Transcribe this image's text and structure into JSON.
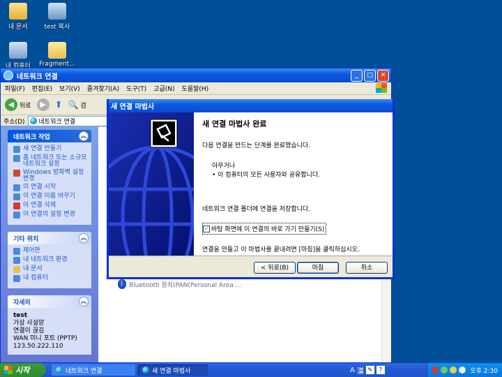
{
  "desktop": {
    "icons": [
      {
        "label": "내 문서",
        "icon": "my-documents-icon"
      },
      {
        "label": "test 복사",
        "icon": "test-copy-icon"
      },
      {
        "label": "내 컴퓨터",
        "icon": "my-computer-icon"
      },
      {
        "label": "Fragment...",
        "icon": "fragment-icon"
      }
    ]
  },
  "explorer": {
    "title": "네트워크 연결",
    "menu": [
      "파일(F)",
      "편집(E)",
      "보기(V)",
      "즐겨찾기(A)",
      "도구(T)",
      "고급(N)",
      "도움말(H)"
    ],
    "toolbar": {
      "back": "뒤로",
      "search": "검"
    },
    "address_label": "주소(D)",
    "address_value": "네트워크 연결",
    "panels": {
      "network_tasks": {
        "title": "네트워크 작업",
        "items": [
          "새 연결 만들기",
          "홈 네트워크 또는 소규모 네트워크 설정",
          "Windows 방화벽 설정 변경",
          "이 연결 시작",
          "이 연결 이름 바꾸기",
          "이 연결 삭제",
          "이 연결의 설정 변경"
        ]
      },
      "other_places": {
        "title": "기타 위치",
        "items": [
          "제어판",
          "내 네트워크 환경",
          "내 문서",
          "내 컴퓨터"
        ]
      },
      "details": {
        "title": "자세히",
        "name": "test",
        "lines": [
          "가상 사설망",
          "연결이 끊김",
          "WAN 미니 포트 (PPTP)",
          "123.50.222.110"
        ]
      }
    },
    "content_item": "Bluetooth 장치(PAN(Personal Area ..."
  },
  "wizard": {
    "title": "새 연결 마법사",
    "heading": "새 연결 마법사 완료",
    "intro": "다음 연결을 만드는 단계를 완료했습니다.",
    "conn_name": "아무거나",
    "conn_detail": "• 이 컴퓨터의 모든 사용자와 공유합니다.",
    "save_text": "네트워크 연결 폴더에 연결을 저장합니다.",
    "shortcut_label": "바탕 화면에 이 연결의 바로 가기 만들기(S)",
    "shortcut_checked": true,
    "finish_text": "연결을 만들고 이 마법사를 끝내려면 [마침]을 클릭하십시오.",
    "buttons": {
      "back": "< 뒤로(B)",
      "finish": "마침",
      "cancel": "취소"
    }
  },
  "taskbar": {
    "start": "시작",
    "tasks": [
      "네트워크 연결",
      "새 연결 마법사"
    ],
    "lang": [
      "A",
      "漢"
    ],
    "clock": "오후 2:30"
  }
}
